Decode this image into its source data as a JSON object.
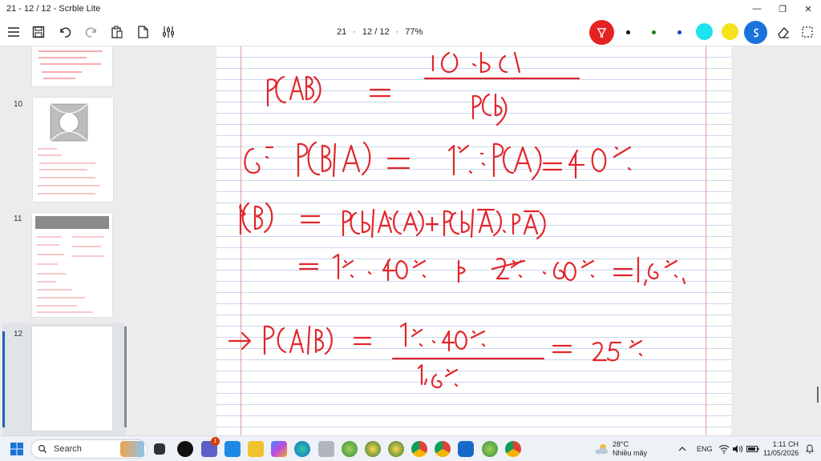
{
  "window": {
    "title": "21 - 12 / 12 - Scrble Lite",
    "minimize": "—",
    "maximize": "❐",
    "close": "✕"
  },
  "toolbar": {
    "page_indicator": "21",
    "page_count": "12 / 12",
    "zoom": "77%",
    "icons": [
      "menu-icon",
      "save-icon",
      "undo-icon",
      "redo-icon",
      "clipboard-icon",
      "page-icon",
      "sliders-icon"
    ],
    "pen_colors": [
      "#111111",
      "#1a7f1a",
      "#1f3fbf",
      "#1de2f0",
      "#f5e21a",
      "#1a73d9"
    ]
  },
  "thumbnails": [
    {
      "number": "10"
    },
    {
      "number": "11"
    },
    {
      "number": "12",
      "selected": true
    }
  ],
  "taskbar": {
    "search_placeholder": "Search",
    "notification_count": "1",
    "weather_temp": "28°C",
    "weather_desc": "Nhiều mây",
    "language": "ENG",
    "time": "1:11 CH",
    "date": "11/05/2026"
  },
  "colors": {
    "ink": "#e2262b",
    "accent": "#1f5fbf"
  }
}
